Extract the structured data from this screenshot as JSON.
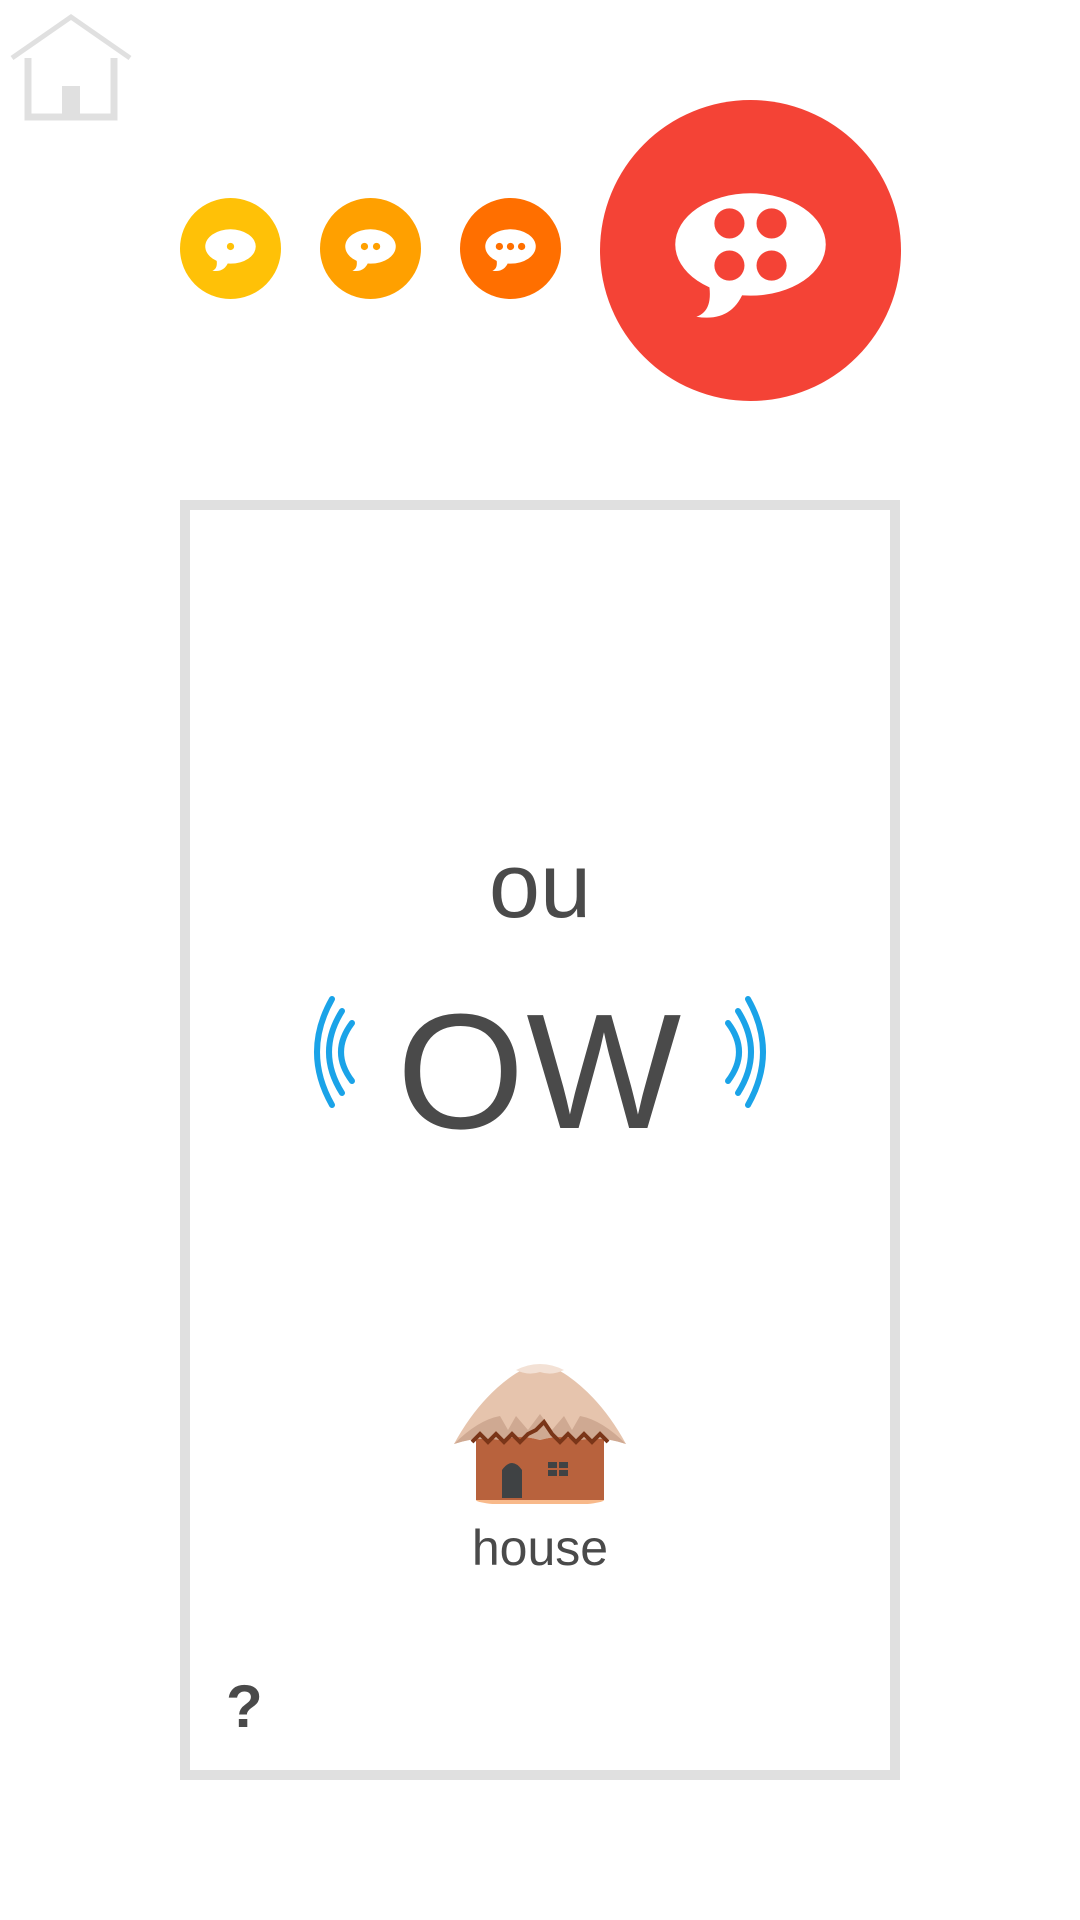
{
  "header": {
    "home_icon": "home-icon"
  },
  "levels": [
    {
      "name": "level-1",
      "dots": 1,
      "color": "#ffc107",
      "icon": "speech-bubble-icon"
    },
    {
      "name": "level-2",
      "dots": 2,
      "color": "#ffa000",
      "icon": "speech-bubble-icon"
    },
    {
      "name": "level-3",
      "dots": 3,
      "color": "#ff6f00",
      "icon": "speech-bubble-icon"
    },
    {
      "name": "level-4",
      "dots": 4,
      "color": "#f44336",
      "icon": "speech-bubble-icon",
      "selected": true
    }
  ],
  "card": {
    "grapheme_small": "ou",
    "grapheme_large": "OW",
    "sound_icon_color": "#1aa3e8",
    "example_word": "house",
    "example_image": "hut-icon",
    "help_label": "?"
  }
}
